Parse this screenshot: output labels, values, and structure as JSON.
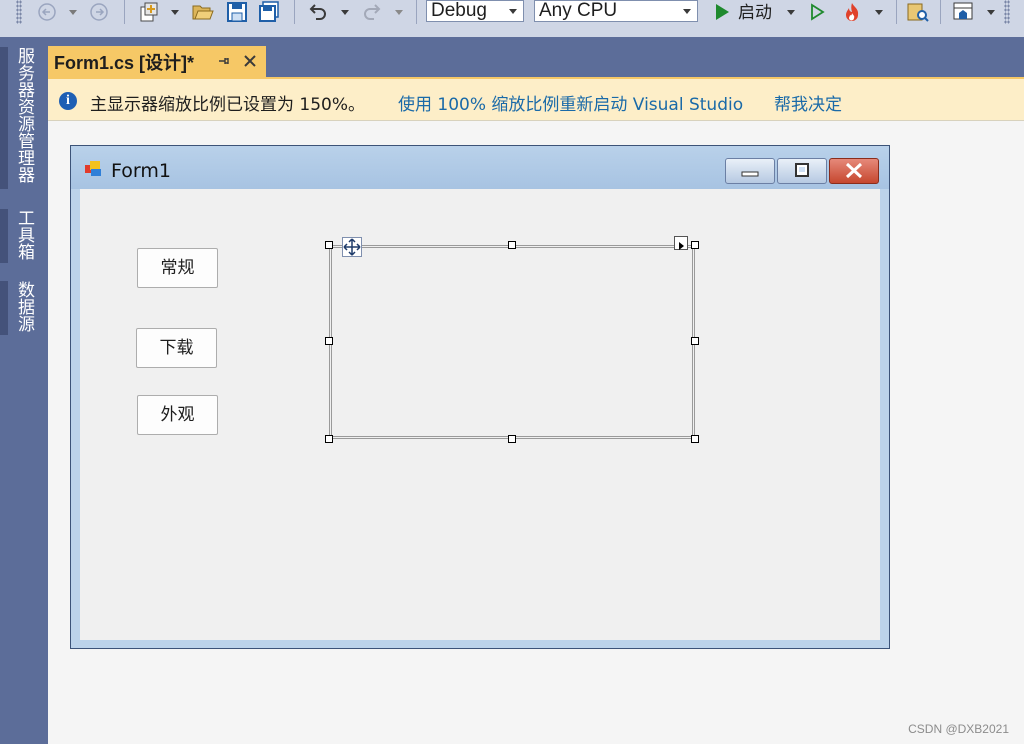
{
  "toolbar": {
    "configuration": "Debug",
    "platform": "Any CPU",
    "run_label": "启动",
    "icons": [
      "back-icon",
      "forward-icon",
      "new-item-icon",
      "open-folder-icon",
      "save-icon",
      "save-all-icon",
      "undo-icon",
      "redo-icon",
      "start-icon",
      "start-without-debug-icon",
      "hot-reload-icon",
      "solution-explorer-icon",
      "window-layout-icon"
    ]
  },
  "left_rail": {
    "tabs": [
      "服务器资源管理器",
      "工具箱",
      "数据源"
    ]
  },
  "document_tab": {
    "title": "Form1.cs [设计]*"
  },
  "infobar": {
    "message": "主显示器缩放比例已设置为 150%。",
    "link_restart": "使用 100% 缩放比例重新启动 Visual Studio",
    "link_help": "帮我决定"
  },
  "form": {
    "title": "Form1",
    "buttons": [
      "常规",
      "下载",
      "外观"
    ]
  },
  "watermark": "CSDN @DXB2021",
  "colors": {
    "accent_tab": "#f6c866",
    "chrome": "#5c6d99",
    "infobar": "#fdeec8",
    "link": "#1a6aa8"
  }
}
